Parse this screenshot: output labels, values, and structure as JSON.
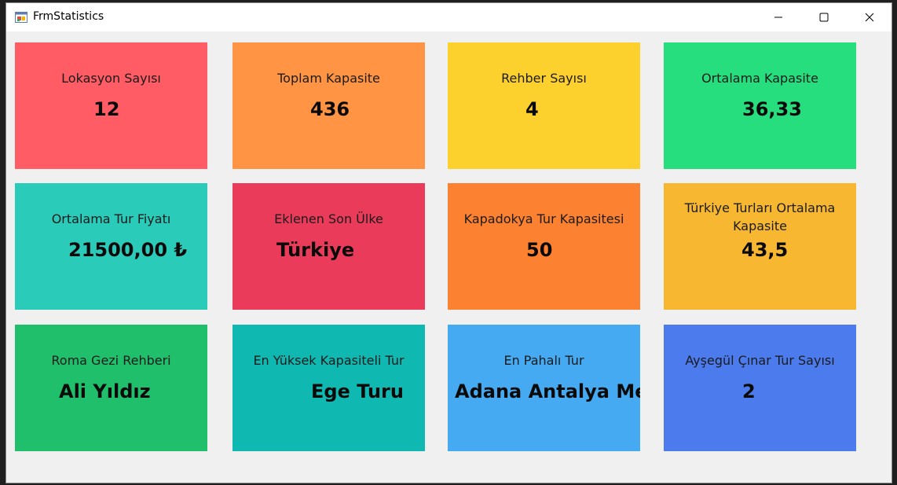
{
  "window": {
    "title": "FrmStatistics",
    "controls": [
      "minimize",
      "maximize",
      "close"
    ]
  },
  "cards": [
    {
      "label": "Lokasyon Sayısı",
      "value": "12",
      "color": "#ff5c66"
    },
    {
      "label": "Toplam Kapasite",
      "value": "436",
      "color": "#ff9544"
    },
    {
      "label": "Rehber Sayısı",
      "value": "4",
      "color": "#fdd12d"
    },
    {
      "label": "Ortalama Kapasite",
      "value": "36,33",
      "color": "#26de7e"
    },
    {
      "label": "Ortalama Tur Fiyatı",
      "value": "21500,00 ₺",
      "color": "#2bcbba"
    },
    {
      "label": "Eklenen Son Ülke",
      "value": "Türkiye",
      "color": "#eb3b5a"
    },
    {
      "label": "Kapadokya Tur Kapasitesi",
      "value": "50",
      "color": "#fc8130"
    },
    {
      "label": "Türkiye Turları Ortalama Kapasite",
      "value": "43,5",
      "color": "#f7b731"
    },
    {
      "label": "Roma Gezi Rehberi",
      "value": "Ali Yıldız",
      "color": "#20bf6b"
    },
    {
      "label": "En Yüksek Kapasiteli Tur",
      "value": "Ege Turu",
      "color": "#0fb9b1"
    },
    {
      "label": "En Pahalı Tur",
      "value": "Adana Antalya Mersin",
      "color": "#45aaf2"
    },
    {
      "label": "Ayşegül Çınar Tur Sayısı",
      "value": "2",
      "color": "#4b7bec"
    }
  ]
}
